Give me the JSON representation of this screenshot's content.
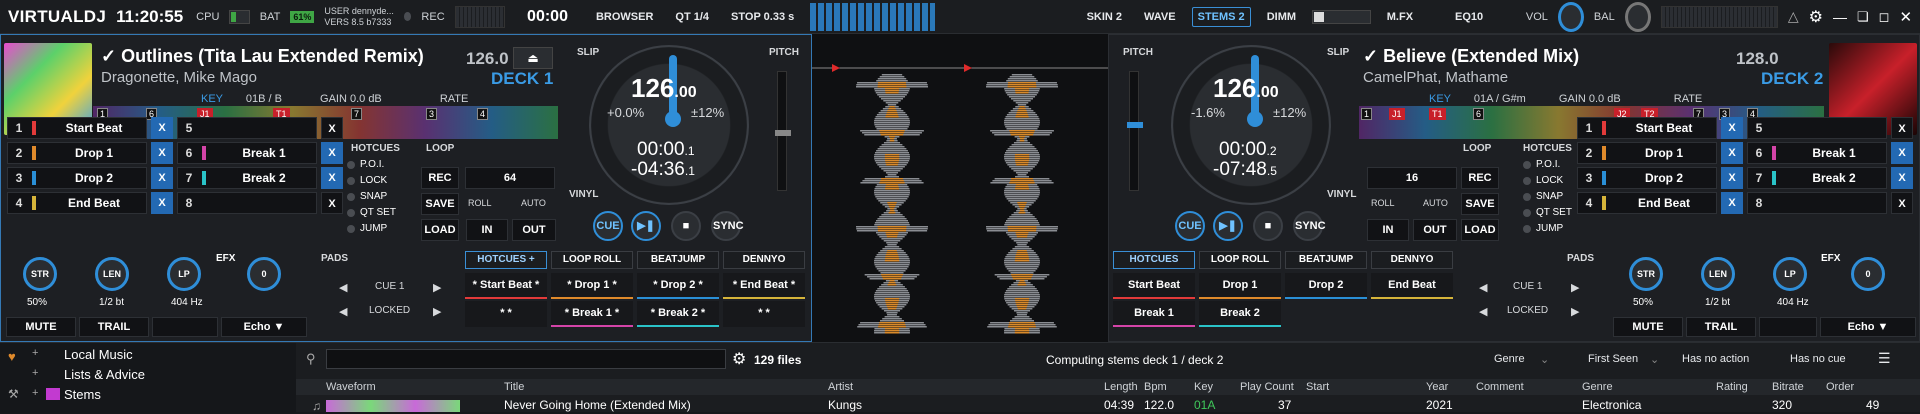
{
  "topbar": {
    "logo": "VIRTUALDJ",
    "clock": "11:20:55",
    "cpu_label": "CPU",
    "bat_label": "BAT",
    "bat_value": "61%",
    "user_line": "USER  dennyde...",
    "vers_line": "VERS  8.5 b7333",
    "rec_label": "REC",
    "rec_timer": "00:00",
    "browser": "BROWSER",
    "qt": "QT 1/4",
    "stop": "STOP 0.33 s",
    "skin": "SKIN 2",
    "wave": "WAVE",
    "stems": "STEMS 2",
    "dimm": "DIMM",
    "mfx": "M.FX",
    "eq": "EQ10",
    "vol": "VOL",
    "bal": "BAL"
  },
  "deck1": {
    "title": "✓ Outlines (Tita Lau Extended Remix)",
    "artist": "Dragonette, Mike Mago",
    "bpm": "126.0",
    "label": "DECK 1",
    "key_label": "KEY",
    "key": "01B / B",
    "gain": "GAIN 0.0 dB",
    "rate": "RATE",
    "slip": "SLIP",
    "pitch": "PITCH",
    "vinyl": "VINYL",
    "jog_bpm": "126",
    "jog_bpm_dec": ".00",
    "jog_pitch": "+0.0%",
    "jog_range": "±12%",
    "elapsed": "00:00",
    "elapsed_dec": ".1",
    "remain": "-04:36",
    "remain_dec": ".1",
    "pads": [
      {
        "num": "1",
        "name": "Start Beat",
        "color": "#e23a3a"
      },
      {
        "num": "2",
        "name": "Drop 1",
        "color": "#e08a2b"
      },
      {
        "num": "3",
        "name": "Drop 2",
        "color": "#2a8fd6"
      },
      {
        "num": "4",
        "name": "End Beat",
        "color": "#d6b43a"
      },
      {
        "num": "5",
        "name": "",
        "color": ""
      },
      {
        "num": "6",
        "name": "Break 1",
        "color": "#d444a8"
      },
      {
        "num": "7",
        "name": "Break 2",
        "color": "#2ac3c8"
      },
      {
        "num": "8",
        "name": "",
        "color": ""
      }
    ],
    "hotcues": "HOTCUES",
    "hc_opts": [
      "P.O.I.",
      "LOCK",
      "SNAP",
      "QT SET",
      "JUMP"
    ],
    "loop": "LOOP",
    "loop_val": "64",
    "rec": "REC",
    "save": "SAVE",
    "load": "LOAD",
    "roll": "ROLL",
    "auto": "AUTO",
    "in": "IN",
    "out": "OUT",
    "cue": "CUE",
    "sync": "SYNC",
    "fx": [
      {
        "lab": "STR",
        "val": "50%"
      },
      {
        "lab": "LEN",
        "val": "1/2 bt"
      },
      {
        "lab": "LP",
        "val": "404 Hz"
      }
    ],
    "efx": "EFX",
    "efx_val": "0",
    "mute": "MUTE",
    "trail": "TRAIL",
    "effect": "Echo",
    "pads_label": "PADS",
    "cue_sel": "CUE 1",
    "locked": "LOCKED",
    "tabs": [
      "HOTCUES +",
      "LOOP ROLL",
      "BEATJUMP",
      "DENNYO"
    ],
    "bpads": [
      {
        "name": "* Start Beat *",
        "color": "#e23a3a"
      },
      {
        "name": "* Drop 1 *",
        "color": "#e08a2b"
      },
      {
        "name": "* Drop 2 *",
        "color": "#2a8fd6"
      },
      {
        "name": "* End Beat *",
        "color": "#d6b43a"
      },
      {
        "name": "* *",
        "color": "#17181b"
      },
      {
        "name": "* Break 1 *",
        "color": "#d444a8"
      },
      {
        "name": "* Break 2 *",
        "color": "#2ac3c8"
      },
      {
        "name": "* *",
        "color": "#17181b"
      }
    ]
  },
  "deck2": {
    "title": "✓ Believe (Extended Mix)",
    "artist": "CamelPhat, Mathame",
    "bpm": "128.0",
    "label": "DECK 2",
    "key_label": "KEY",
    "key": "01A / G#m",
    "gain": "GAIN 0.0 dB",
    "rate": "RATE",
    "slip": "SLIP",
    "pitch": "PITCH",
    "vinyl": "VINYL",
    "jog_bpm": "126",
    "jog_bpm_dec": ".00",
    "jog_pitch": "-1.6%",
    "jog_range": "±12%",
    "elapsed": "00:00",
    "elapsed_dec": ".2",
    "remain": "-07:48",
    "remain_dec": ".5",
    "pads": [
      {
        "num": "1",
        "name": "Start Beat",
        "color": "#e23a3a"
      },
      {
        "num": "2",
        "name": "Drop 1",
        "color": "#e08a2b"
      },
      {
        "num": "3",
        "name": "Drop 2",
        "color": "#2a8fd6"
      },
      {
        "num": "4",
        "name": "End Beat",
        "color": "#d6b43a"
      },
      {
        "num": "5",
        "name": "",
        "color": ""
      },
      {
        "num": "6",
        "name": "Break 1",
        "color": "#d444a8"
      },
      {
        "num": "7",
        "name": "Break 2",
        "color": "#2ac3c8"
      },
      {
        "num": "8",
        "name": "",
        "color": ""
      }
    ],
    "hotcues": "HOTCUES",
    "hc_opts": [
      "P.O.I.",
      "LOCK",
      "SNAP",
      "QT SET",
      "JUMP"
    ],
    "loop": "LOOP",
    "loop_val": "16",
    "rec": "REC",
    "save": "SAVE",
    "load": "LOAD",
    "roll": "ROLL",
    "auto": "AUTO",
    "in": "IN",
    "out": "OUT",
    "cue": "CUE",
    "sync": "SYNC",
    "fx": [
      {
        "lab": "STR",
        "val": "50%"
      },
      {
        "lab": "LEN",
        "val": "1/2 bt"
      },
      {
        "lab": "LP",
        "val": "404 Hz"
      }
    ],
    "efx": "EFX",
    "efx_val": "0",
    "mute": "MUTE",
    "trail": "TRAIL",
    "effect": "Echo",
    "pads_label": "PADS",
    "cue_sel": "CUE 1",
    "locked": "LOCKED",
    "tabs": [
      "HOTCUES",
      "LOOP ROLL",
      "BEATJUMP",
      "DENNYO"
    ],
    "bpads": [
      {
        "name": "Start Beat",
        "color": "#e23a3a"
      },
      {
        "name": "Drop 1",
        "color": "#e08a2b"
      },
      {
        "name": "Drop 2",
        "color": "#2a8fd6"
      },
      {
        "name": "End Beat",
        "color": "#d6b43a"
      },
      {
        "name": "Break 1",
        "color": "#d444a8"
      },
      {
        "name": "Break 2",
        "color": "#2ac3c8"
      }
    ]
  },
  "browser": {
    "sidebar": [
      "Local Music",
      "Lists & Advice",
      "Stems"
    ],
    "file_count": "129 files",
    "status": "Computing stems deck 1 / deck 2",
    "filters": [
      "Genre",
      "First Seen",
      "Has no action",
      "Has no cue"
    ],
    "columns": [
      "Waveform",
      "Title",
      "Artist",
      "Length",
      "Bpm",
      "Key",
      "Play Count",
      "Start",
      "Year",
      "Comment",
      "Genre",
      "Rating",
      "Bitrate",
      "Order"
    ],
    "row": {
      "title": "Never Going Home (Extended Mix)",
      "artist": "Kungs",
      "length": "04:39",
      "bpm": "122.0",
      "key": "01A",
      "plays": "37",
      "year": "2021",
      "genre": "Electronica",
      "bitrate": "320",
      "order": "49"
    }
  }
}
